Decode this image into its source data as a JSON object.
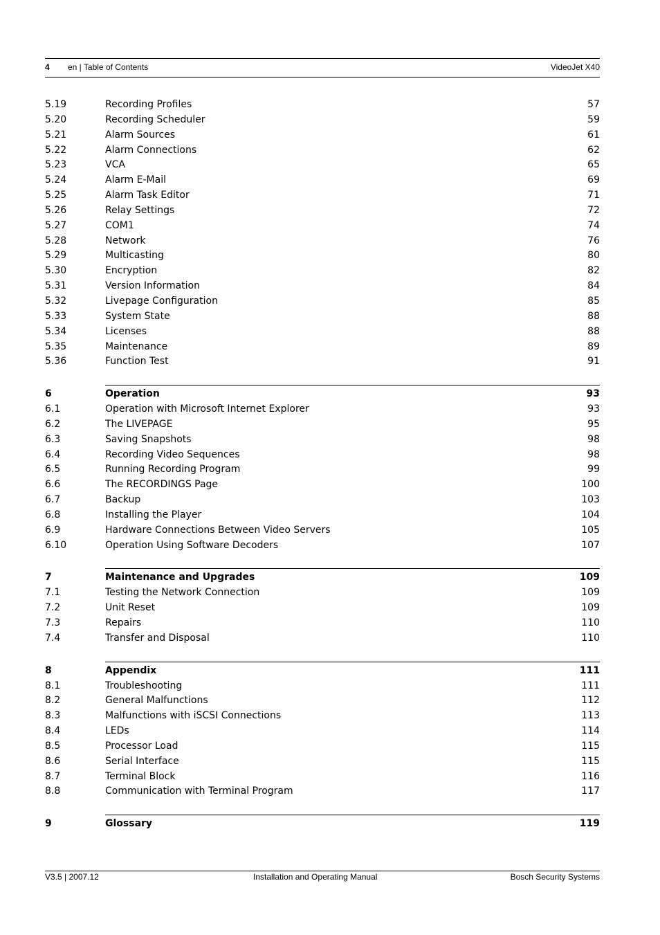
{
  "header": {
    "page_number": "4",
    "section": "en | Table of Contents",
    "product": "VideoJet X40"
  },
  "toc": {
    "continued": [
      {
        "num": "5.19",
        "title": "Recording Profiles",
        "page": "57"
      },
      {
        "num": "5.20",
        "title": "Recording Scheduler",
        "page": "59"
      },
      {
        "num": "5.21",
        "title": "Alarm Sources",
        "page": "61"
      },
      {
        "num": "5.22",
        "title": "Alarm Connections",
        "page": "62"
      },
      {
        "num": "5.23",
        "title": "VCA",
        "page": "65"
      },
      {
        "num": "5.24",
        "title": "Alarm E-Mail",
        "page": "69"
      },
      {
        "num": "5.25",
        "title": "Alarm Task Editor",
        "page": "71"
      },
      {
        "num": "5.26",
        "title": "Relay Settings",
        "page": "72"
      },
      {
        "num": "5.27",
        "title": "COM1",
        "page": "74"
      },
      {
        "num": "5.28",
        "title": "Network",
        "page": "76"
      },
      {
        "num": "5.29",
        "title": "Multicasting",
        "page": "80"
      },
      {
        "num": "5.30",
        "title": "Encryption",
        "page": "82"
      },
      {
        "num": "5.31",
        "title": "Version Information",
        "page": "84"
      },
      {
        "num": "5.32",
        "title": "Livepage Configuration",
        "page": "85"
      },
      {
        "num": "5.33",
        "title": "System State",
        "page": "88"
      },
      {
        "num": "5.34",
        "title": "Licenses",
        "page": "88"
      },
      {
        "num": "5.35",
        "title": "Maintenance",
        "page": "89"
      },
      {
        "num": "5.36",
        "title": "Function Test",
        "page": "91"
      }
    ],
    "chapters": [
      {
        "num": "6",
        "title": "Operation",
        "page": "93",
        "items": [
          {
            "num": "6.1",
            "title": "Operation with Microsoft Internet Explorer",
            "page": "93"
          },
          {
            "num": "6.2",
            "title": "The LIVEPAGE",
            "page": "95"
          },
          {
            "num": "6.3",
            "title": "Saving Snapshots",
            "page": "98"
          },
          {
            "num": "6.4",
            "title": "Recording Video Sequences",
            "page": "98"
          },
          {
            "num": "6.5",
            "title": "Running Recording Program",
            "page": "99"
          },
          {
            "num": "6.6",
            "title": "The RECORDINGS Page",
            "page": "100"
          },
          {
            "num": "6.7",
            "title": "Backup",
            "page": "103"
          },
          {
            "num": "6.8",
            "title": "Installing the Player",
            "page": "104"
          },
          {
            "num": "6.9",
            "title": "Hardware Connections Between Video Servers",
            "page": "105"
          },
          {
            "num": "6.10",
            "title": "Operation Using Software Decoders",
            "page": "107"
          }
        ]
      },
      {
        "num": "7",
        "title": "Maintenance and Upgrades",
        "page": "109",
        "items": [
          {
            "num": "7.1",
            "title": "Testing the Network Connection",
            "page": "109"
          },
          {
            "num": "7.2",
            "title": "Unit Reset",
            "page": "109"
          },
          {
            "num": "7.3",
            "title": "Repairs",
            "page": "110"
          },
          {
            "num": "7.4",
            "title": "Transfer and Disposal",
            "page": "110"
          }
        ]
      },
      {
        "num": "8",
        "title": "Appendix",
        "page": "111",
        "items": [
          {
            "num": "8.1",
            "title": "Troubleshooting",
            "page": "111"
          },
          {
            "num": "8.2",
            "title": "General Malfunctions",
            "page": "112"
          },
          {
            "num": "8.3",
            "title": "Malfunctions with iSCSI Connections",
            "page": "113"
          },
          {
            "num": "8.4",
            "title": "LEDs",
            "page": "114"
          },
          {
            "num": "8.5",
            "title": "Processor Load",
            "page": "115"
          },
          {
            "num": "8.6",
            "title": "Serial Interface",
            "page": "115"
          },
          {
            "num": "8.7",
            "title": "Terminal Block",
            "page": "116"
          },
          {
            "num": "8.8",
            "title": "Communication with Terminal Program",
            "page": "117"
          }
        ]
      },
      {
        "num": "9",
        "title": "Glossary",
        "page": "119",
        "items": []
      }
    ]
  },
  "footer": {
    "version": "V3.5 | 2007.12",
    "document": "Installation and Operating Manual",
    "company": "Bosch Security Systems"
  }
}
